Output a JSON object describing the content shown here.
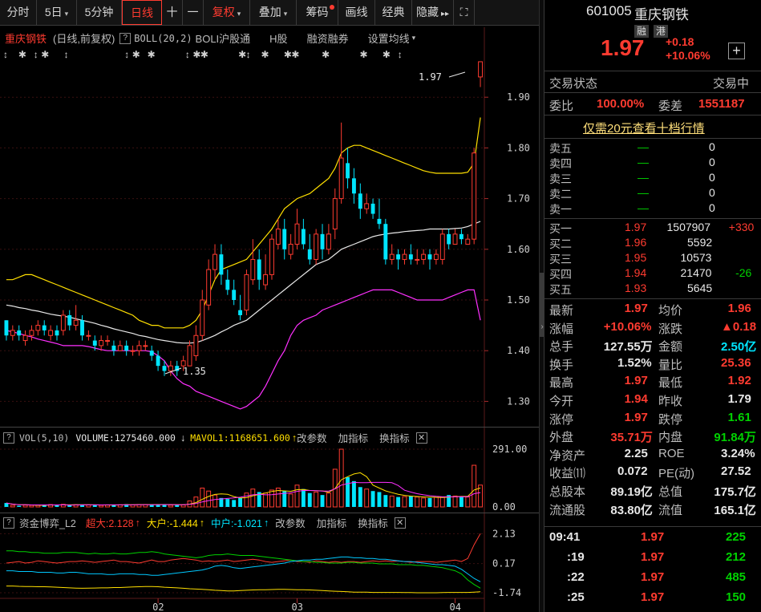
{
  "toolbar": {
    "items": [
      {
        "label": "分时"
      },
      {
        "label": "5日",
        "caret": true
      },
      {
        "label": "5分钟",
        "caret": false
      },
      {
        "label": "日线",
        "active": true
      },
      {
        "label": "十"
      },
      {
        "label": "一"
      },
      {
        "label": "复权",
        "caret": true,
        "red": true
      },
      {
        "label": "叠加",
        "caret": true
      },
      {
        "label": "筹码",
        "dot": true
      },
      {
        "label": "画线"
      },
      {
        "label": "经典"
      },
      {
        "label": "隐藏",
        "more": "▸▸"
      },
      {
        "label": "⛶"
      }
    ]
  },
  "main_chart": {
    "title": "重庆钢铁",
    "subtitle": "(日线,前复权)",
    "indicator": "BOLL(20,2)",
    "tags": [
      "BOLI沪股通",
      "H股",
      "融资融券",
      "设置均线"
    ],
    "price_ticks": [
      "1.90",
      "1.80",
      "1.70",
      "1.60",
      "1.50",
      "1.40",
      "1.30"
    ],
    "high_label": "1.97",
    "low_label": "1.35"
  },
  "volume_panel": {
    "name": "VOL(5,10)",
    "volume_label": "VOLUME:1275460.000",
    "mavol_label": "MAVOL1:1168651.600",
    "change_params": "改参数",
    "add_indicator": "加指标",
    "switch_indicator": "换指标",
    "ticks": [
      "291.00",
      "0.00"
    ]
  },
  "capital_panel": {
    "name": "资金博弈_L2",
    "super_label": "超大:2.128",
    "big_label": "大户:-1.444",
    "mid_label": "中户:-1.021",
    "change_params": "改参数",
    "add_indicator": "加指标",
    "switch_indicator": "换指标",
    "ticks": [
      "2.13",
      "0.17",
      "-1.74"
    ]
  },
  "x_axis": {
    "labels": [
      "02",
      "03",
      "04"
    ]
  },
  "stock": {
    "code": "601005",
    "name": "重庆钢铁",
    "badge1": "融",
    "badge2": "港",
    "price": "1.97",
    "change": "+0.18",
    "change_pct": "+10.06%",
    "add_btn": "+",
    "status_label": "交易状态",
    "status_value": "交易中",
    "weibi_label": "委比",
    "weibi_value": "100.00%",
    "weicha_label": "委差",
    "weicha_value": "1551187",
    "promo": "仅需20元查看十档行情"
  },
  "order_book": {
    "asks": [
      {
        "label": "卖五",
        "price": "—",
        "vol": "0"
      },
      {
        "label": "卖四",
        "price": "—",
        "vol": "0"
      },
      {
        "label": "卖三",
        "price": "—",
        "vol": "0"
      },
      {
        "label": "卖二",
        "price": "—",
        "vol": "0"
      },
      {
        "label": "卖一",
        "price": "—",
        "vol": "0"
      }
    ],
    "bids": [
      {
        "label": "买一",
        "price": "1.97",
        "vol": "1507907",
        "chg": "+330",
        "chg_color": "red"
      },
      {
        "label": "买二",
        "price": "1.96",
        "vol": "5592",
        "chg": "",
        "chg_color": "red"
      },
      {
        "label": "买三",
        "price": "1.95",
        "vol": "10573",
        "chg": "",
        "chg_color": "red"
      },
      {
        "label": "买四",
        "price": "1.94",
        "vol": "21470",
        "chg": "-26",
        "chg_color": "green"
      },
      {
        "label": "买五",
        "price": "1.93",
        "vol": "5645",
        "chg": "",
        "chg_color": "red"
      }
    ]
  },
  "quote": [
    {
      "l1": "最新",
      "v1": "1.97",
      "c1": "red",
      "l2": "均价",
      "v2": "1.96",
      "c2": "red"
    },
    {
      "l1": "涨幅",
      "v1": "+10.06%",
      "c1": "red",
      "l2": "涨跌",
      "v2": "▲0.18",
      "c2": "red"
    },
    {
      "l1": "总手",
      "v1": "127.55万",
      "c1": "white",
      "l2": "金额",
      "v2": "2.50亿",
      "c2": "cyan"
    },
    {
      "l1": "换手",
      "v1": "1.52%",
      "c1": "white",
      "l2": "量比",
      "v2": "25.36",
      "c2": "red"
    },
    {
      "l1": "最高",
      "v1": "1.97",
      "c1": "red",
      "l2": "最低",
      "v2": "1.92",
      "c2": "red"
    },
    {
      "l1": "今开",
      "v1": "1.94",
      "c1": "red",
      "l2": "昨收",
      "v2": "1.79",
      "c2": "white"
    },
    {
      "l1": "涨停",
      "v1": "1.97",
      "c1": "red",
      "l2": "跌停",
      "v2": "1.61",
      "c2": "green"
    },
    {
      "l1": "外盘",
      "v1": "35.71万",
      "c1": "red",
      "l2": "内盘",
      "v2": "91.84万",
      "c2": "green"
    },
    {
      "l1": "净资产",
      "v1": "2.25",
      "c1": "white",
      "l2": "ROE",
      "v2": "3.24%",
      "c2": "white"
    },
    {
      "l1": "收益⑾",
      "v1": "0.072",
      "c1": "white",
      "l2": "PE(动)",
      "v2": "27.52",
      "c2": "white"
    },
    {
      "l1": "总股本",
      "v1": "89.19亿",
      "c1": "white",
      "l2": "总值",
      "v2": "175.7亿",
      "c2": "white"
    },
    {
      "l1": "流通股",
      "v1": "83.80亿",
      "c1": "white",
      "l2": "流值",
      "v2": "165.1亿",
      "c2": "white"
    }
  ],
  "ticks": [
    {
      "time": "09:41",
      "price": "1.97",
      "vol": "225"
    },
    {
      "time": ":19",
      "price": "1.97",
      "vol": "212"
    },
    {
      "time": ":22",
      "price": "1.97",
      "vol": "485"
    },
    {
      "time": ":25",
      "price": "1.97",
      "vol": "150"
    }
  ],
  "chart_data": {
    "type": "candlestick",
    "title": "重庆钢铁",
    "ylim": [
      1.25,
      2.0
    ],
    "candles": [
      [
        1.46,
        1.43,
        1.46,
        1.42
      ],
      [
        1.43,
        1.44,
        1.45,
        1.42
      ],
      [
        1.44,
        1.43,
        1.45,
        1.42
      ],
      [
        1.42,
        1.43,
        1.44,
        1.41
      ],
      [
        1.43,
        1.44,
        1.45,
        1.42
      ],
      [
        1.44,
        1.45,
        1.46,
        1.43
      ],
      [
        1.45,
        1.44,
        1.46,
        1.43
      ],
      [
        1.43,
        1.44,
        1.45,
        1.42
      ],
      [
        1.44,
        1.43,
        1.45,
        1.42
      ],
      [
        1.44,
        1.47,
        1.48,
        1.43
      ],
      [
        1.47,
        1.45,
        1.48,
        1.44
      ],
      [
        1.45,
        1.46,
        1.49,
        1.44
      ],
      [
        1.46,
        1.43,
        1.47,
        1.42
      ],
      [
        1.43,
        1.43,
        1.44,
        1.42
      ],
      [
        1.42,
        1.41,
        1.43,
        1.4
      ],
      [
        1.41,
        1.42,
        1.43,
        1.4
      ],
      [
        1.42,
        1.42,
        1.43,
        1.41
      ],
      [
        1.41,
        1.4,
        1.42,
        1.39
      ],
      [
        1.4,
        1.41,
        1.42,
        1.4
      ],
      [
        1.41,
        1.4,
        1.42,
        1.39
      ],
      [
        1.4,
        1.4,
        1.41,
        1.39
      ],
      [
        1.4,
        1.41,
        1.42,
        1.39
      ],
      [
        1.41,
        1.41,
        1.42,
        1.4
      ],
      [
        1.4,
        1.39,
        1.41,
        1.38
      ],
      [
        1.39,
        1.37,
        1.4,
        1.36
      ],
      [
        1.37,
        1.36,
        1.38,
        1.35
      ],
      [
        1.36,
        1.37,
        1.38,
        1.35
      ],
      [
        1.37,
        1.36,
        1.38,
        1.35
      ],
      [
        1.37,
        1.38,
        1.39,
        1.36
      ],
      [
        1.37,
        1.41,
        1.42,
        1.37
      ],
      [
        1.39,
        1.43,
        1.45,
        1.38
      ],
      [
        1.43,
        1.5,
        1.52,
        1.42
      ],
      [
        1.49,
        1.56,
        1.58,
        1.48
      ],
      [
        1.56,
        1.59,
        1.61,
        1.54
      ],
      [
        1.59,
        1.55,
        1.61,
        1.53
      ],
      [
        1.54,
        1.52,
        1.56,
        1.51
      ],
      [
        1.52,
        1.5,
        1.54,
        1.49
      ],
      [
        1.48,
        1.47,
        1.51,
        1.46
      ],
      [
        1.48,
        1.55,
        1.56,
        1.47
      ],
      [
        1.54,
        1.58,
        1.62,
        1.53
      ],
      [
        1.58,
        1.54,
        1.6,
        1.52
      ],
      [
        1.53,
        1.55,
        1.59,
        1.52
      ],
      [
        1.55,
        1.62,
        1.63,
        1.54
      ],
      [
        1.61,
        1.64,
        1.66,
        1.6
      ],
      [
        1.64,
        1.6,
        1.66,
        1.58
      ],
      [
        1.59,
        1.61,
        1.63,
        1.58
      ],
      [
        1.61,
        1.65,
        1.68,
        1.6
      ],
      [
        1.64,
        1.61,
        1.66,
        1.6
      ],
      [
        1.6,
        1.58,
        1.63,
        1.57
      ],
      [
        1.58,
        1.63,
        1.64,
        1.57
      ],
      [
        1.63,
        1.6,
        1.65,
        1.58
      ],
      [
        1.6,
        1.63,
        1.65,
        1.59
      ],
      [
        1.64,
        1.7,
        1.72,
        1.62
      ],
      [
        1.7,
        1.78,
        1.85,
        1.69
      ],
      [
        1.77,
        1.74,
        1.8,
        1.72
      ],
      [
        1.74,
        1.71,
        1.76,
        1.69
      ],
      [
        1.71,
        1.68,
        1.73,
        1.66
      ],
      [
        1.68,
        1.69,
        1.71,
        1.67
      ],
      [
        1.69,
        1.67,
        1.7,
        1.66
      ],
      [
        1.66,
        1.65,
        1.7,
        1.64
      ],
      [
        1.65,
        1.58,
        1.66,
        1.57
      ],
      [
        1.58,
        1.59,
        1.61,
        1.57
      ],
      [
        1.59,
        1.58,
        1.6,
        1.56
      ],
      [
        1.58,
        1.59,
        1.6,
        1.57
      ],
      [
        1.59,
        1.58,
        1.61,
        1.57
      ],
      [
        1.58,
        1.58,
        1.6,
        1.57
      ],
      [
        1.58,
        1.59,
        1.6,
        1.57
      ],
      [
        1.59,
        1.58,
        1.6,
        1.56
      ],
      [
        1.58,
        1.59,
        1.6,
        1.57
      ],
      [
        1.58,
        1.63,
        1.64,
        1.57
      ],
      [
        1.63,
        1.61,
        1.64,
        1.6
      ],
      [
        1.61,
        1.63,
        1.64,
        1.61
      ],
      [
        1.63,
        1.62,
        1.64,
        1.61
      ],
      [
        1.61,
        1.62,
        1.63,
        1.61
      ],
      [
        1.62,
        1.79,
        1.8,
        1.61
      ],
      [
        1.94,
        1.97,
        1.97,
        1.92
      ]
    ],
    "boll_upper": [
      1.54,
      1.54,
      1.545,
      1.55,
      1.55,
      1.545,
      1.54,
      1.535,
      1.53,
      1.525,
      1.52,
      1.515,
      1.51,
      1.505,
      1.5,
      1.495,
      1.49,
      1.485,
      1.48,
      1.475,
      1.47,
      1.46,
      1.455,
      1.45,
      1.45,
      1.445,
      1.445,
      1.445,
      1.445,
      1.45,
      1.46,
      1.48,
      1.51,
      1.54,
      1.56,
      1.565,
      1.57,
      1.575,
      1.58,
      1.595,
      1.61,
      1.625,
      1.64,
      1.66,
      1.68,
      1.69,
      1.7,
      1.705,
      1.71,
      1.72,
      1.73,
      1.74,
      1.76,
      1.79,
      1.8,
      1.805,
      1.805,
      1.8,
      1.795,
      1.79,
      1.785,
      1.78,
      1.775,
      1.77,
      1.765,
      1.76,
      1.755,
      1.752,
      1.75,
      1.75,
      1.75,
      1.75,
      1.75,
      1.752,
      1.77,
      1.86
    ],
    "boll_mid": [
      1.49,
      1.488,
      1.485,
      1.483,
      1.48,
      1.478,
      1.475,
      1.472,
      1.47,
      1.468,
      1.466,
      1.463,
      1.46,
      1.457,
      1.454,
      1.45,
      1.447,
      1.443,
      1.44,
      1.437,
      1.434,
      1.43,
      1.428,
      1.425,
      1.422,
      1.42,
      1.418,
      1.416,
      1.415,
      1.415,
      1.416,
      1.42,
      1.425,
      1.43,
      1.437,
      1.443,
      1.45,
      1.455,
      1.46,
      1.47,
      1.48,
      1.49,
      1.5,
      1.51,
      1.52,
      1.53,
      1.54,
      1.55,
      1.56,
      1.57,
      1.575,
      1.58,
      1.59,
      1.6,
      1.605,
      1.61,
      1.615,
      1.62,
      1.625,
      1.628,
      1.63,
      1.632,
      1.633,
      1.635,
      1.636,
      1.637,
      1.638,
      1.64,
      1.64,
      1.64,
      1.64,
      1.641,
      1.642,
      1.645,
      1.65,
      1.655
    ],
    "boll_lower": [
      1.44,
      1.437,
      1.434,
      1.43,
      1.427,
      1.423,
      1.42,
      1.417,
      1.414,
      1.41,
      1.41,
      1.41,
      1.41,
      1.408,
      1.405,
      1.402,
      1.4,
      1.4,
      1.4,
      1.4,
      1.4,
      1.4,
      1.4,
      1.398,
      1.39,
      1.38,
      1.36,
      1.345,
      1.335,
      1.33,
      1.32,
      1.315,
      1.31,
      1.305,
      1.3,
      1.295,
      1.29,
      1.285,
      1.29,
      1.3,
      1.31,
      1.33,
      1.355,
      1.38,
      1.4,
      1.43,
      1.45,
      1.46,
      1.465,
      1.47,
      1.48,
      1.485,
      1.49,
      1.495,
      1.5,
      1.505,
      1.51,
      1.515,
      1.52,
      1.52,
      1.52,
      1.52,
      1.515,
      1.51,
      1.505,
      1.5,
      1.5,
      1.5,
      1.5,
      1.5,
      1.505,
      1.51,
      1.515,
      1.52,
      1.52,
      1.46
    ],
    "volumes": [
      20,
      8,
      6,
      9,
      8,
      10,
      9,
      12,
      9,
      13,
      10,
      11,
      12,
      10,
      9,
      8,
      10,
      12,
      11,
      14,
      10,
      12,
      12,
      11,
      14,
      12,
      9,
      10,
      10,
      30,
      50,
      95,
      80,
      60,
      45,
      40,
      35,
      45,
      70,
      90,
      75,
      70,
      85,
      95,
      80,
      65,
      110,
      90,
      70,
      75,
      60,
      70,
      190,
      291,
      150,
      130,
      100,
      90,
      80,
      75,
      60,
      55,
      50,
      52,
      55,
      50,
      45,
      45,
      48,
      50,
      60,
      55,
      52,
      50,
      210,
      110
    ],
    "capital": {
      "super": [
        0.2,
        0.25,
        0.3,
        0.2,
        0.25,
        0.35,
        0.3,
        0.25,
        0.2,
        0.25,
        0.3,
        0.3,
        0.35,
        0.3,
        0.25,
        0.3,
        0.35,
        0.4,
        0.3,
        0.3,
        0.25,
        0.2,
        0.3,
        0.4,
        0.3,
        0.3,
        0.4,
        0.45,
        0.5,
        0.45,
        0.4,
        0.3,
        0.35,
        0.3,
        0.35,
        0.4,
        0.3,
        0.35,
        0.4,
        0.45,
        0.4,
        0.3,
        0.25,
        0.3,
        0.35,
        0.4,
        0.3,
        0.3,
        0.25,
        0.35,
        0.3,
        0.25,
        0.3,
        0.25,
        0.3,
        0.3,
        0.25,
        0.3,
        0.35,
        0.3,
        0.35,
        0.3,
        0.35,
        0.3,
        0.25,
        0.3,
        0.3,
        0.3,
        0.25,
        0.3,
        0.35,
        0.4,
        0.3,
        0.5,
        1.4,
        2.13
      ],
      "big": [
        1.0,
        1.0,
        0.95,
        0.95,
        0.9,
        0.9,
        0.85,
        0.85,
        0.85,
        0.9,
        0.9,
        0.9,
        0.85,
        0.8,
        0.85,
        0.8,
        0.8,
        0.85,
        0.8,
        0.8,
        0.85,
        0.9,
        0.9,
        0.95,
        0.9,
        0.8,
        0.75,
        0.7,
        0.65,
        0.6,
        0.55,
        0.6,
        0.7,
        0.75,
        0.75,
        0.8,
        0.75,
        0.7,
        0.7,
        0.7,
        0.65,
        0.6,
        0.55,
        0.5,
        0.45,
        0.4,
        0.35,
        0.3,
        0.3,
        0.25,
        0.25,
        0.2,
        0.2,
        0.2,
        0.25,
        0.25,
        0.2,
        0.2,
        0.2,
        0.15,
        0.15,
        0.15,
        0.1,
        0.1,
        0.1,
        0.05,
        0.05,
        0.0,
        -0.05,
        -0.1,
        -0.2,
        -0.3,
        -0.5,
        -0.9,
        -1.2,
        -1.444
      ],
      "mid": [
        -0.3,
        -0.3,
        -0.35,
        -0.35,
        -0.35,
        -0.4,
        -0.4,
        -0.4,
        -0.45,
        -0.45,
        -0.4,
        -0.4,
        -0.45,
        -0.5,
        -0.5,
        -0.5,
        -0.55,
        -0.55,
        -0.5,
        -0.5,
        -0.5,
        -0.55,
        -0.55,
        -0.6,
        -0.6,
        -0.55,
        -0.5,
        -0.45,
        -0.4,
        -0.35,
        -0.3,
        -0.25,
        -0.15,
        0.0,
        0.05,
        0.0,
        -0.1,
        -0.15,
        -0.1,
        -0.05,
        0.0,
        0.05,
        0.1,
        0.15,
        0.2,
        0.3,
        0.35,
        0.4,
        0.4,
        0.45,
        0.45,
        0.5,
        0.55,
        0.6,
        0.6,
        0.55,
        0.55,
        0.5,
        0.5,
        0.45,
        0.45,
        0.4,
        0.35,
        0.3,
        0.3,
        0.25,
        0.2,
        0.15,
        0.1,
        0.1,
        0.05,
        0.0,
        -0.2,
        -0.5,
        -0.8,
        -1.021
      ],
      "small": [
        -1.3,
        -1.3,
        -1.32,
        -1.33,
        -1.34,
        -1.35,
        -1.35,
        -1.36,
        -1.38,
        -1.4,
        -1.42,
        -1.44,
        -1.45,
        -1.44,
        -1.43,
        -1.42,
        -1.42,
        -1.4,
        -1.4,
        -1.38,
        -1.36,
        -1.35,
        -1.34,
        -1.34,
        -1.35,
        -1.38,
        -1.4,
        -1.42,
        -1.45,
        -1.48,
        -1.5,
        -1.52,
        -1.55,
        -1.58,
        -1.6,
        -1.62,
        -1.62,
        -1.6,
        -1.58,
        -1.56,
        -1.55,
        -1.54,
        -1.53,
        -1.52,
        -1.52,
        -1.53,
        -1.54,
        -1.55,
        -1.56,
        -1.58,
        -1.6,
        -1.62,
        -1.64,
        -1.66,
        -1.68,
        -1.7,
        -1.7,
        -1.7,
        -1.72,
        -1.72,
        -1.72,
        -1.72,
        -1.72,
        -1.73,
        -1.73,
        -1.74,
        -1.74,
        -1.74,
        -1.74,
        -1.73,
        -1.72,
        -1.72,
        -1.72,
        -1.72,
        -1.7,
        -1.68
      ]
    }
  },
  "colors": {
    "up": "#ff3b30",
    "down": "#00e5ff",
    "boll_upper": "#ffdf00",
    "boll_mid": "#e8e8e8",
    "boll_lower": "#ff30ff",
    "mavol5": "#ffdf00",
    "mavol10": "#ff30ff",
    "grid": "#3a1010"
  }
}
